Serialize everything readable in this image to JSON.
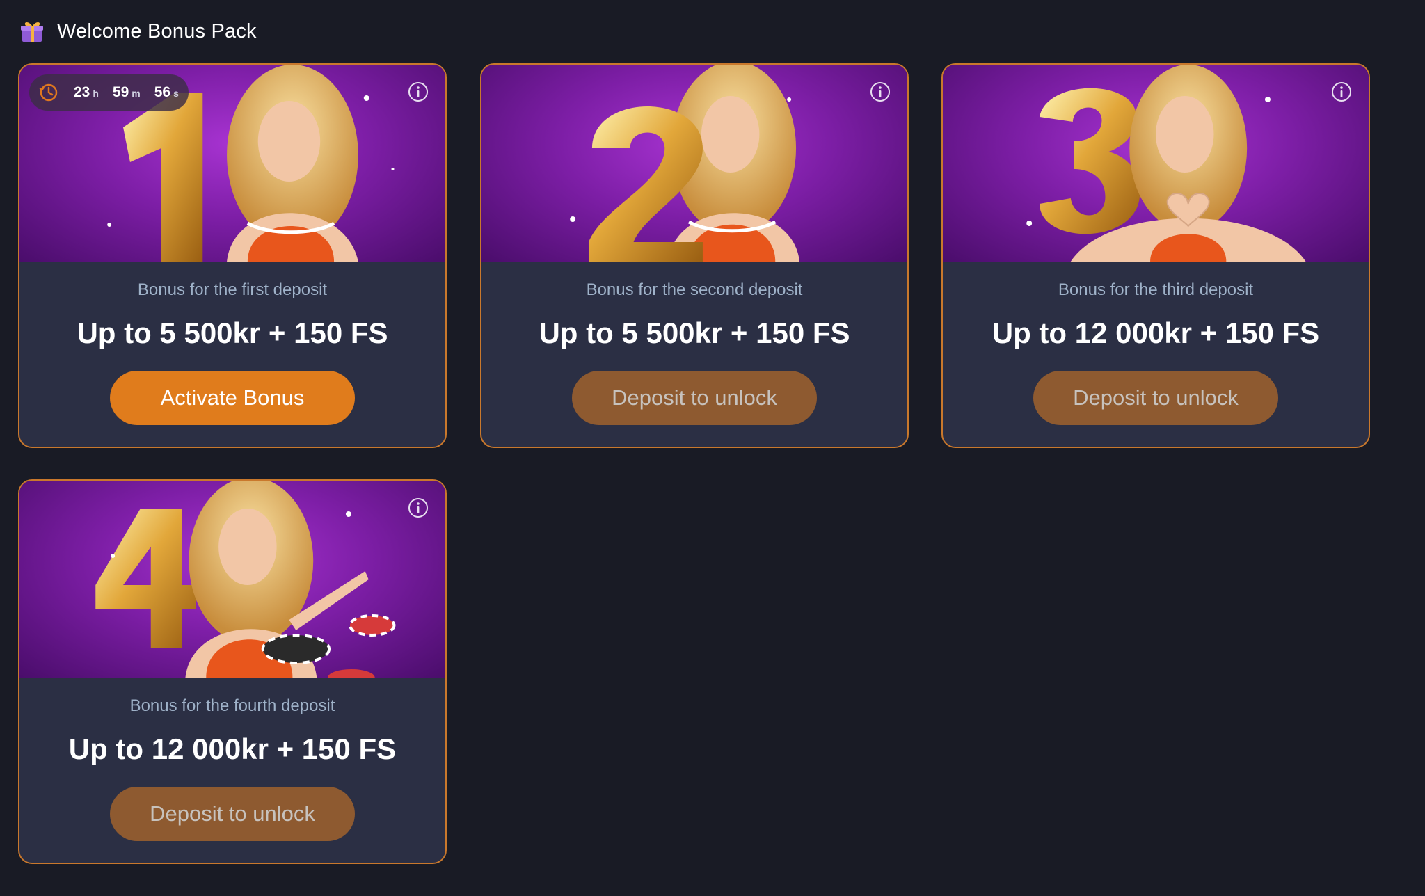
{
  "header": {
    "icon": "gift-icon",
    "title": "Welcome Bonus Pack"
  },
  "colors": {
    "background": "#191b25",
    "card_background": "#2b2f44",
    "card_border": "#c9782c",
    "button_active": "#e07c1c",
    "button_locked": "#8e5a30",
    "banner_purple": "#8a22b5",
    "subtitle_text": "#9fb2c9"
  },
  "timer": {
    "icon": "clock-history-icon",
    "hours": "23",
    "hours_suffix": "h",
    "minutes": "59",
    "minutes_suffix": "m",
    "seconds": "56",
    "seconds_suffix": "s"
  },
  "cards": [
    {
      "number": "1",
      "subtitle": "Bonus for the first deposit",
      "amount": "Up to 5 500kr + 150 FS",
      "button": "Activate Bonus",
      "button_state": "active",
      "info_icon": "info-icon"
    },
    {
      "number": "2",
      "subtitle": "Bonus for the second deposit",
      "amount": "Up to 5 500kr + 150 FS",
      "button": "Deposit to unlock",
      "button_state": "locked",
      "info_icon": "info-icon"
    },
    {
      "number": "3",
      "subtitle": "Bonus for the third deposit",
      "amount": "Up to 12 000kr + 150 FS",
      "button": "Deposit to unlock",
      "button_state": "locked",
      "info_icon": "info-icon"
    },
    {
      "number": "4",
      "subtitle": "Bonus for the fourth deposit",
      "amount": "Up to 12 000kr + 150 FS",
      "button": "Deposit to unlock",
      "button_state": "locked",
      "info_icon": "info-icon"
    }
  ]
}
